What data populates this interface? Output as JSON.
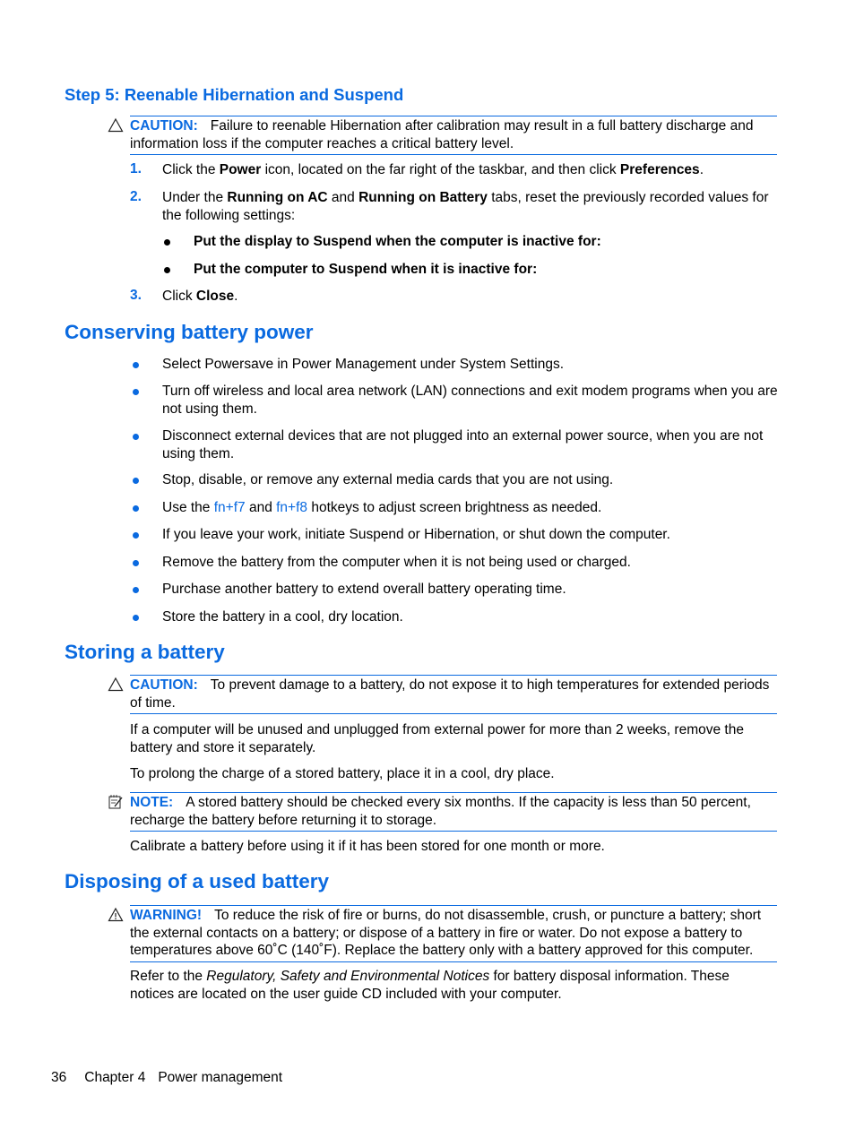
{
  "step5": {
    "heading": "Step 5: Reenable Hibernation and Suspend",
    "caution": {
      "icon": "caution-triangle-icon",
      "label": "CAUTION:",
      "text": "Failure to reenable Hibernation after calibration may result in a full battery discharge and information loss if the computer reaches a critical battery level."
    },
    "steps": [
      {
        "num": "1.",
        "pre": "Click the ",
        "b1": "Power",
        "mid": " icon, located on the far right of the taskbar, and then click ",
        "b2": "Preferences",
        "post": "."
      },
      {
        "num": "2.",
        "pre": "Under the ",
        "b1": "Running on AC",
        "mid": " and ",
        "b2": "Running on Battery",
        "post": " tabs, reset the previously recorded values for the following settings:"
      },
      {
        "num": "3.",
        "pre": "Click ",
        "b1": "Close",
        "post": "."
      }
    ],
    "sub_bullets": [
      "Put the display to Suspend when the computer is inactive for:",
      "Put the computer to Suspend when it is inactive for:"
    ]
  },
  "conserving": {
    "heading": "Conserving battery power",
    "bullets": [
      "Select Powersave in Power Management under System Settings.",
      "Turn off wireless and local area network (LAN) connections and exit modem programs when you are not using them.",
      "Disconnect external devices that are not plugged into an external power source, when you are not using them.",
      "Stop, disable, or remove any external media cards that you are not using.",
      "If you leave your work, initiate Suspend or Hibernation, or shut down the computer.",
      "Remove the battery from the computer when it is not being used or charged.",
      "Purchase another battery to extend overall battery operating time.",
      "Store the battery in a cool, dry location."
    ],
    "hotkey_bullet": {
      "pre": "Use the ",
      "link1": "fn+f7",
      "mid": " and ",
      "link2": "fn+f8",
      "post": " hotkeys to adjust screen brightness as needed."
    }
  },
  "storing": {
    "heading": "Storing a battery",
    "caution": {
      "icon": "caution-triangle-icon",
      "label": "CAUTION:",
      "text": "To prevent damage to a battery, do not expose it to high temperatures for extended periods of time."
    },
    "para1": "If a computer will be unused and unplugged from external power for more than 2 weeks, remove the battery and store it separately.",
    "para2": "To prolong the charge of a stored battery, place it in a cool, dry place.",
    "note": {
      "icon": "note-pad-icon",
      "label": "NOTE:",
      "text": "A stored battery should be checked every six months. If the capacity is less than 50 percent, recharge the battery before returning it to storage."
    },
    "para3": "Calibrate a battery before using it if it has been stored for one month or more."
  },
  "disposing": {
    "heading": "Disposing of a used battery",
    "warning": {
      "icon": "warning-triangle-icon",
      "label": "WARNING!",
      "text": "To reduce the risk of fire or burns, do not disassemble, crush, or puncture a battery; short the external contacts on a battery; or dispose of a battery in fire or water. Do not expose a battery to temperatures above 60˚C (140˚F). Replace the battery only with a battery approved for this computer."
    },
    "para": {
      "pre": "Refer to the ",
      "italic": "Regulatory, Safety and Environmental Notices",
      "post": " for battery disposal information. These notices are located on the user guide CD included with your computer."
    }
  },
  "footer": {
    "page_number": "36",
    "chapter": "Chapter 4",
    "title": "Power management"
  }
}
